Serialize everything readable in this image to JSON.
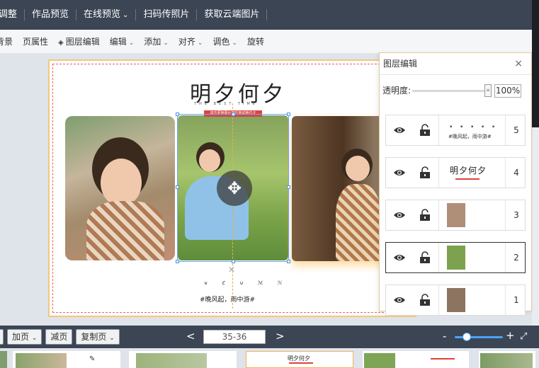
{
  "topbar": {
    "items": [
      "调整",
      "作品预览",
      "在线预览",
      "扫码传照片",
      "获取云端图片"
    ],
    "dropdown_index": 2
  },
  "toolbar": {
    "items": [
      {
        "label": "背景",
        "dropdown": false
      },
      {
        "label": "页属性",
        "dropdown": false
      },
      {
        "label": "图层编辑",
        "dropdown": false,
        "icon": "layers-icon"
      },
      {
        "label": "编辑",
        "dropdown": true
      },
      {
        "label": "添加",
        "dropdown": true
      },
      {
        "label": "对齐",
        "dropdown": true
      },
      {
        "label": "调色",
        "dropdown": true
      },
      {
        "label": "旋转",
        "dropdown": false
      }
    ]
  },
  "page": {
    "title": "明夕何夕",
    "subtitle": "THE BEST TIME",
    "red_tag": "双击更换图片按住拖动换位子",
    "icons_row": "⊌ ℭ ⊍ ℳ ℋ",
    "caption": "#晚风起，雨中游#"
  },
  "layer_panel": {
    "title": "图层编辑",
    "close": "×",
    "opacity_label": "透明度:",
    "opacity_value": "100%",
    "opacity_fraction": 1.0,
    "layers": [
      {
        "number": "5",
        "thumb": "text",
        "thumb_title": "",
        "thumb_sub": "#晚风起，雨中游#",
        "selected": false
      },
      {
        "number": "4",
        "thumb": "title",
        "thumb_title": "明夕何夕",
        "thumb_sub": "",
        "selected": false
      },
      {
        "number": "3",
        "thumb": "photo",
        "thumb_title": "",
        "thumb_sub": "",
        "selected": false
      },
      {
        "number": "2",
        "thumb": "photo",
        "thumb_title": "",
        "thumb_sub": "",
        "selected": true
      },
      {
        "number": "1",
        "thumb": "photo",
        "thumb_title": "",
        "thumb_sub": "",
        "selected": false
      }
    ]
  },
  "bottombar": {
    "add_page": "加页",
    "remove_page": "减页",
    "copy_page": "复制页",
    "page_range": "35-36",
    "prev": "<",
    "next": ">",
    "zoom_minus": "-",
    "zoom_plus": "+",
    "zoom_level": 0.25
  },
  "thumbstrip": {
    "active_title": "明夕何夕"
  },
  "colors": {
    "topbar": "#3c4554",
    "accent_orange": "#f5c67c",
    "selection_blue": "#6aa8ff",
    "red_tag": "#d9453c"
  }
}
